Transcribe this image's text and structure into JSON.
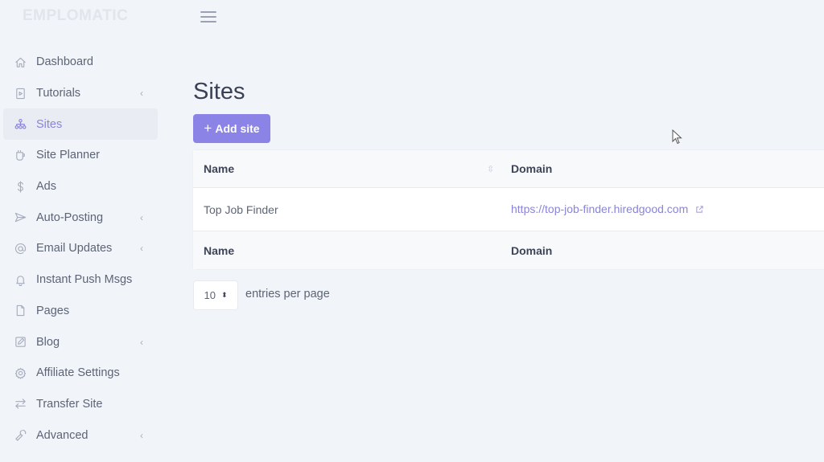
{
  "app": {
    "brand": "EMPLOMATIC"
  },
  "sidebar": {
    "items": [
      {
        "label": "Dashboard",
        "icon": "home-icon",
        "has_children": false,
        "active": false
      },
      {
        "label": "Tutorials",
        "icon": "video-file-icon",
        "has_children": true,
        "active": false
      },
      {
        "label": "Sites",
        "icon": "sitemap-icon",
        "has_children": false,
        "active": true
      },
      {
        "label": "Site Planner",
        "icon": "cup-icon",
        "has_children": false,
        "active": false
      },
      {
        "label": "Ads",
        "icon": "dollar-icon",
        "has_children": false,
        "active": false
      },
      {
        "label": "Auto-Posting",
        "icon": "send-icon",
        "has_children": true,
        "active": false
      },
      {
        "label": "Email Updates",
        "icon": "at-icon",
        "has_children": true,
        "active": false
      },
      {
        "label": "Instant Push Msgs",
        "icon": "bell-icon",
        "has_children": false,
        "active": false
      },
      {
        "label": "Pages",
        "icon": "file-icon",
        "has_children": false,
        "active": false
      },
      {
        "label": "Blog",
        "icon": "edit-icon",
        "has_children": true,
        "active": false
      },
      {
        "label": "Affiliate Settings",
        "icon": "gear-icon",
        "has_children": false,
        "active": false
      },
      {
        "label": "Transfer Site",
        "icon": "transfer-icon",
        "has_children": false,
        "active": false
      },
      {
        "label": "Advanced",
        "icon": "wrench-icon",
        "has_children": true,
        "active": false
      }
    ],
    "chevron": "‹"
  },
  "main": {
    "title": "Sites",
    "add_button": {
      "icon": "+",
      "label": "Add site"
    },
    "table": {
      "columns": [
        "Name",
        "Domain"
      ],
      "rows": [
        {
          "name": "Top Job Finder",
          "domain": "https://top-job-finder.hiredgood.com"
        }
      ],
      "footer": [
        "Name",
        "Domain"
      ]
    },
    "pagination": {
      "per_page_value": "10",
      "per_page_label": "entries per page"
    }
  },
  "colors": {
    "accent": "#8b83e6",
    "background": "#f1f4f9",
    "link": "#8a84d8"
  }
}
